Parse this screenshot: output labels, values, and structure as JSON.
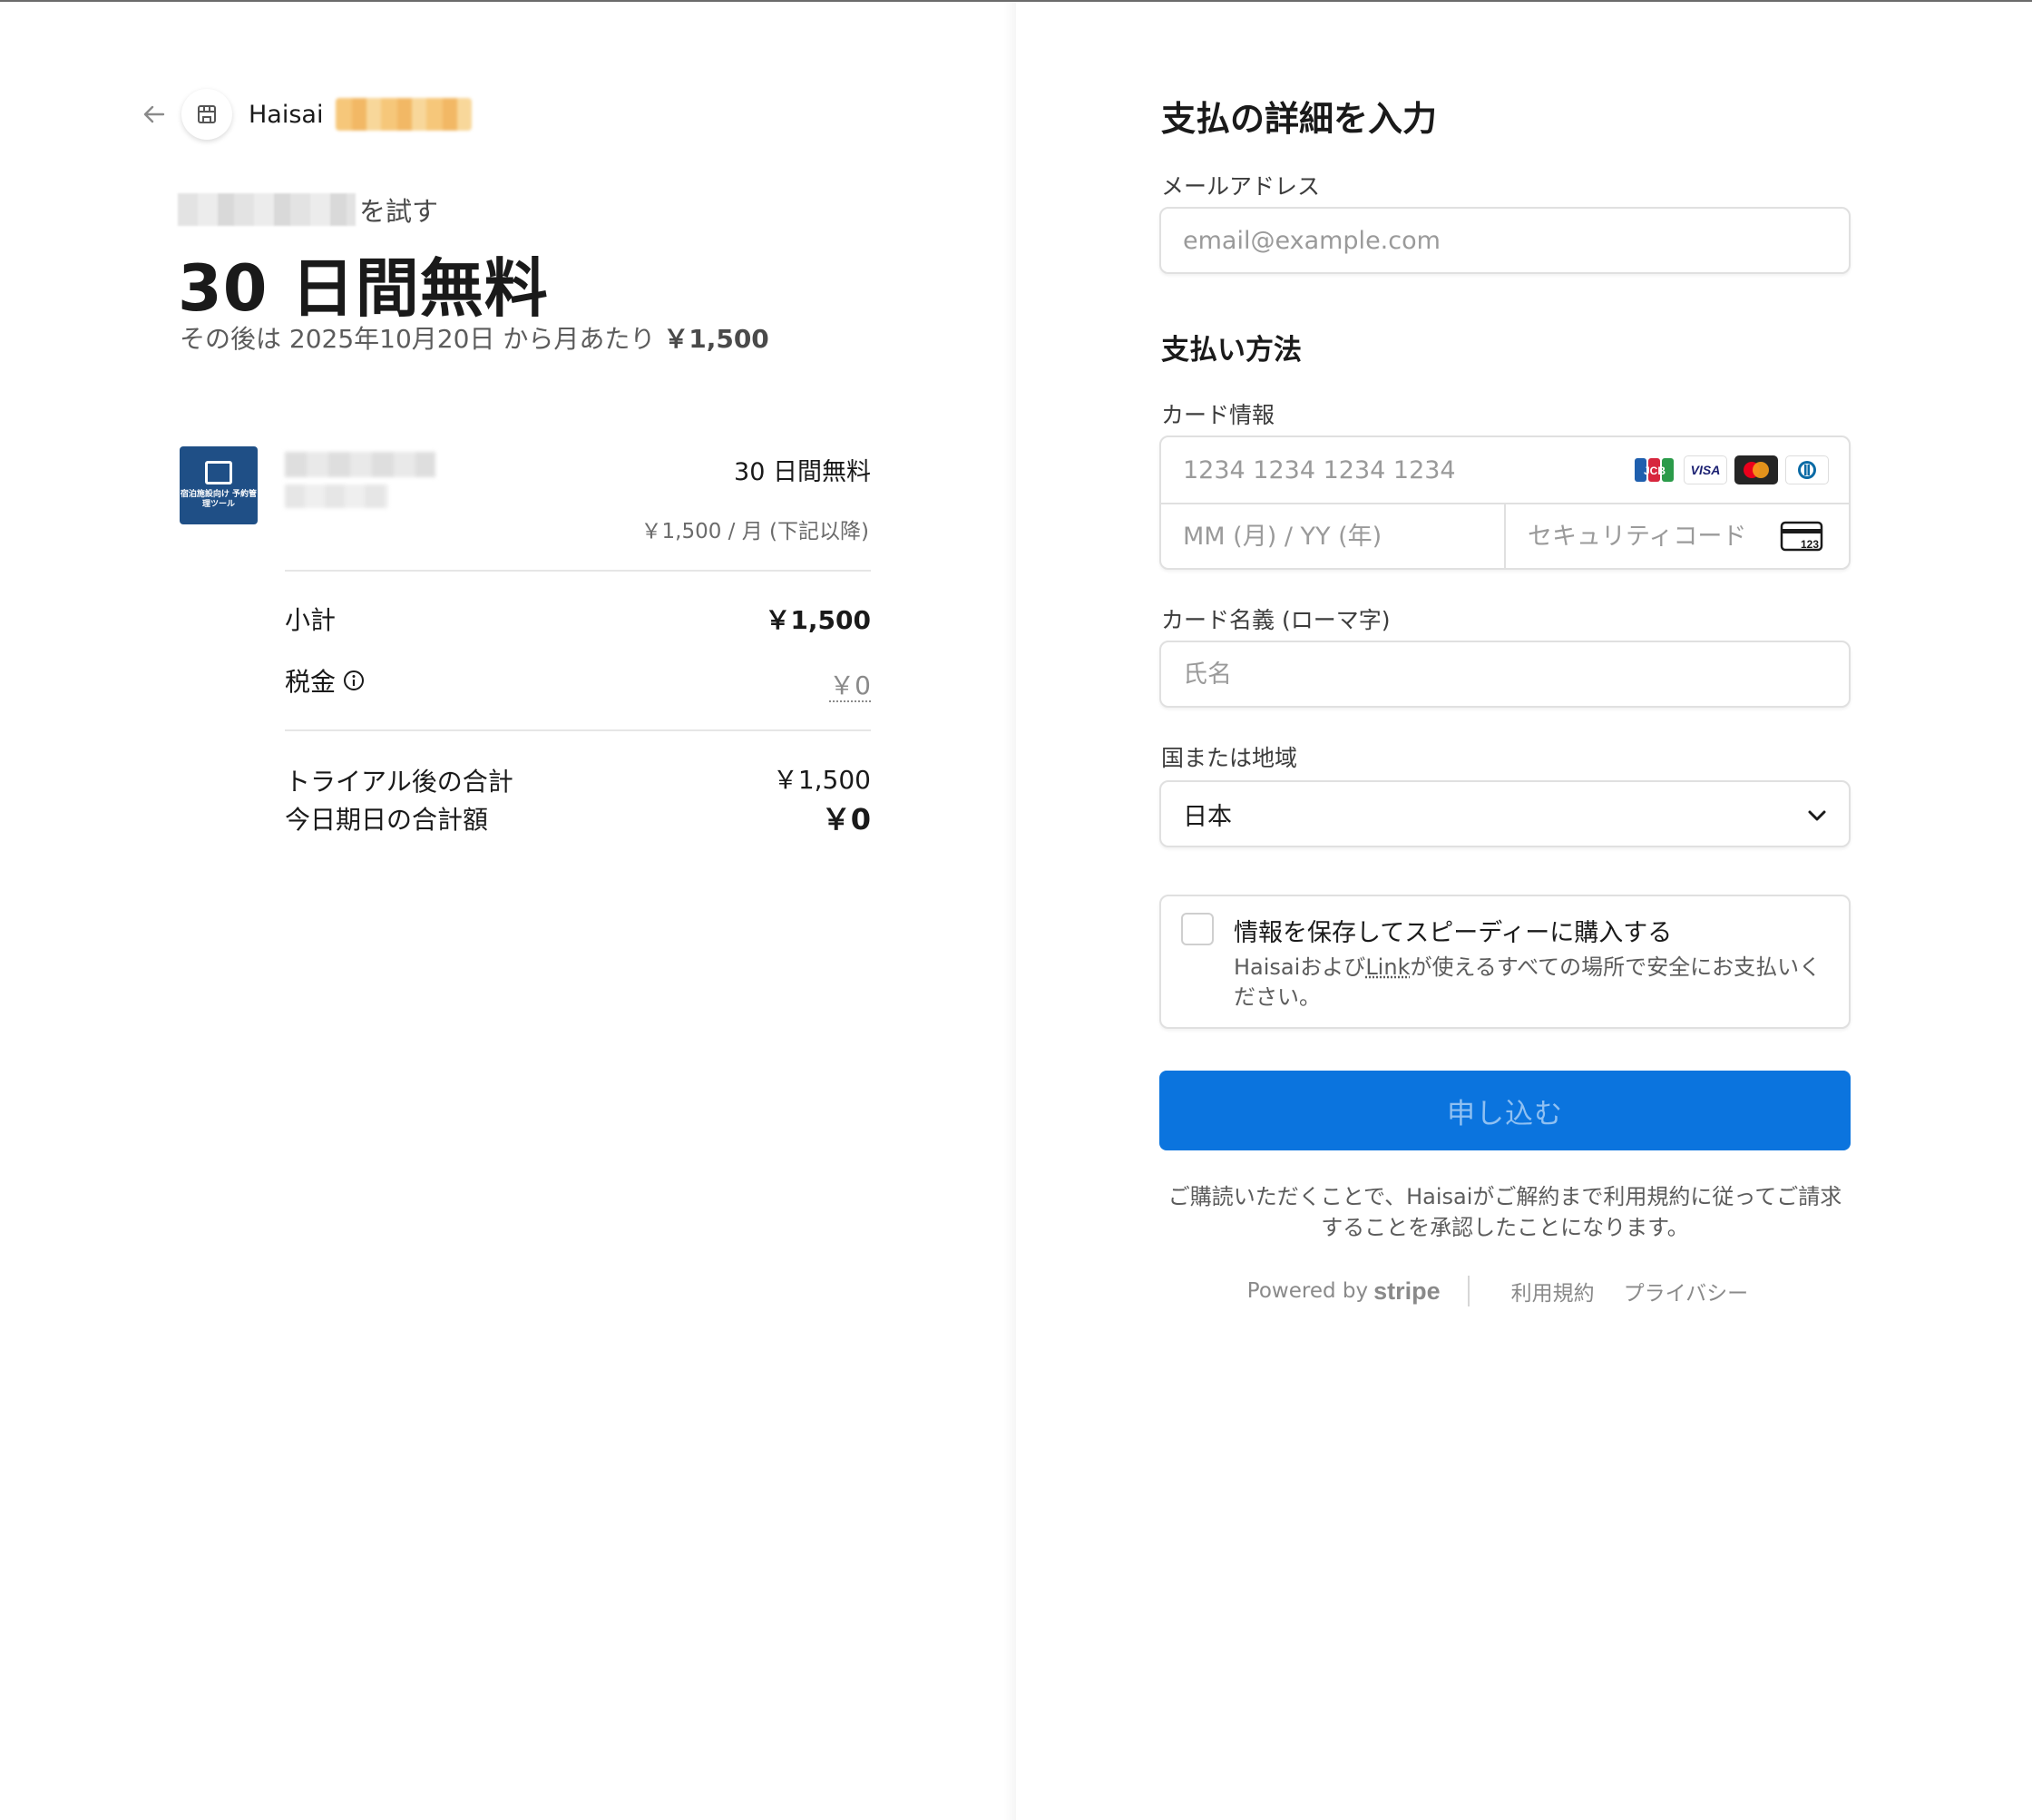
{
  "brand": {
    "name": "Haisai"
  },
  "summary": {
    "try_suffix": "を試す",
    "trial_title": "30 日間無料",
    "after_prefix": "その後は 2025年10月20日 から月あたり ",
    "after_price": "￥1,500"
  },
  "product": {
    "image_text": "宿泊施設向け 予約管理ツール",
    "trial_label": "30 日間無料",
    "price_detail": "￥1,500 / 月 (下記以降)"
  },
  "totals": {
    "subtotal_label": "小計",
    "subtotal_value": "￥1,500",
    "tax_label": "税金",
    "tax_value": "￥0",
    "after_trial_label": "トライアル後の合計",
    "after_trial_value": "￥1,500",
    "today_label": "今日期日の合計額",
    "today_value": "￥0"
  },
  "form": {
    "title": "支払の詳細を入力",
    "email_label": "メールアドレス",
    "email_placeholder": "email@example.com",
    "payment_method_title": "支払い方法",
    "card_label": "カード情報",
    "card_number_placeholder": "1234 1234 1234 1234",
    "card_expiry_placeholder": "MM (月) / YY (年)",
    "card_cvc_placeholder": "セキュリティコード",
    "card_brands": [
      "JCB",
      "VISA",
      "Mastercard",
      "Diners"
    ],
    "cardholder_label": "カード名義 (ローマ字)",
    "cardholder_placeholder": "氏名",
    "country_label": "国または地域",
    "country_value": "日本",
    "save_title": "情報を保存してスピーディーに購入する",
    "save_desc_prefix": "Haisaiおよび",
    "save_desc_link": "Link",
    "save_desc_suffix": "が使えるすべての場所で安全にお支払いください。",
    "submit_label": "申し込む",
    "legal_text": "ご購読いただくことで、Haisaiがご解約まで利用規約に従ってご請求することを承認したことになります。"
  },
  "footer": {
    "powered_by": "Powered by",
    "stripe": "stripe",
    "terms": "利用規約",
    "privacy": "プライバシー"
  },
  "colors": {
    "primary_button": "#0b74de",
    "product_tile": "#1f4f86"
  }
}
